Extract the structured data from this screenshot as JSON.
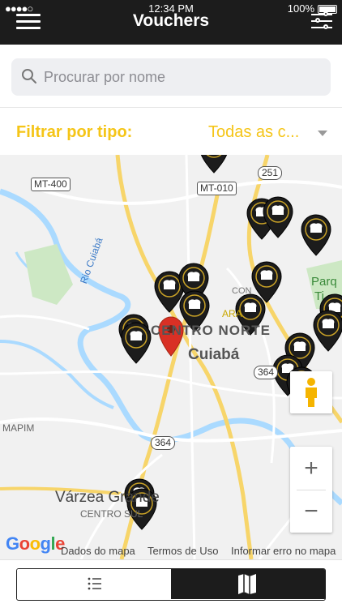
{
  "status_bar": {
    "carrier": "●●●●○ ",
    "time": "12:34 PM",
    "battery": "100%"
  },
  "header": {
    "title": "Vouchers"
  },
  "search": {
    "placeholder": "Procurar por nome",
    "value": ""
  },
  "filter": {
    "label": "Filtrar por tipo:",
    "value": "Todas as c..."
  },
  "map": {
    "places": [
      "CENTRO NORTE",
      "Cuiabá",
      "Várzea Grande",
      "CENTRO SUL",
      "MAPIM",
      "Rio Cuiabá",
      "Parq",
      "Ti",
      "ARA",
      "CON"
    ],
    "roads": [
      "MT-400",
      "MT-010",
      "251",
      "364",
      "364"
    ],
    "footer": {
      "data": "Dados do mapa",
      "terms": "Termos de Uso",
      "report": "Informar erro no mapa"
    },
    "logo": "Google",
    "zoom_in": "+",
    "zoom_out": "−"
  },
  "colors": {
    "accent": "#f5c518",
    "header_bg": "#1c1c1c",
    "pin_red": "#d93025",
    "water": "#aadaff"
  },
  "tabs": [
    {
      "icon": "list-icon",
      "selected": false
    },
    {
      "icon": "map-icon",
      "selected": true
    }
  ]
}
